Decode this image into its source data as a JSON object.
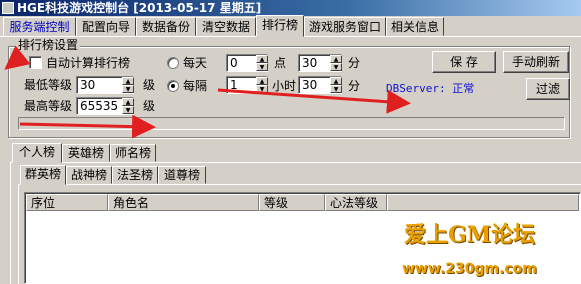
{
  "window": {
    "title": "HGE科技游戏控制台 [2013-05-17 星期五]"
  },
  "tabs": [
    "服务端控制",
    "配置向导",
    "数据备份",
    "清空数据",
    "排行榜",
    "游戏服务窗口",
    "相关信息"
  ],
  "group": {
    "title": "排行榜设置",
    "auto_calc_label": "自动计算排行榜",
    "min_level_label": "最低等级",
    "min_level_value": "30",
    "max_level_label": "最高等级",
    "max_level_value": "65535",
    "level_unit": "级",
    "daily_label": "每天",
    "daily_hour_value": "0",
    "hour_unit": "点",
    "daily_minute_value": "30",
    "minute_unit": "分",
    "interval_label": "每隔",
    "interval_hour_value": "1",
    "interval_hour_unit": "小时",
    "interval_minute_value": "30",
    "save_label": "保 存",
    "refresh_label": "手动刷新",
    "filter_label": "过滤",
    "status_text": "DBServer: 正常"
  },
  "subtabs": [
    "个人榜",
    "英雄榜",
    "师名榜"
  ],
  "subtabs_level2": [
    "群英榜",
    "战神榜",
    "法圣榜",
    "道尊榜"
  ],
  "table": {
    "columns": [
      "序位",
      "角色名",
      "等级",
      "心法等级"
    ]
  },
  "watermark": {
    "main": "爱上GM论坛",
    "url": "www.230gm.com"
  },
  "colors": {
    "accent_arrow": "#e02020",
    "status_text": "#1010d0"
  },
  "selection": {
    "active_tab": "排行榜",
    "interval_mode": "每隔",
    "auto_calc_checked": false
  }
}
